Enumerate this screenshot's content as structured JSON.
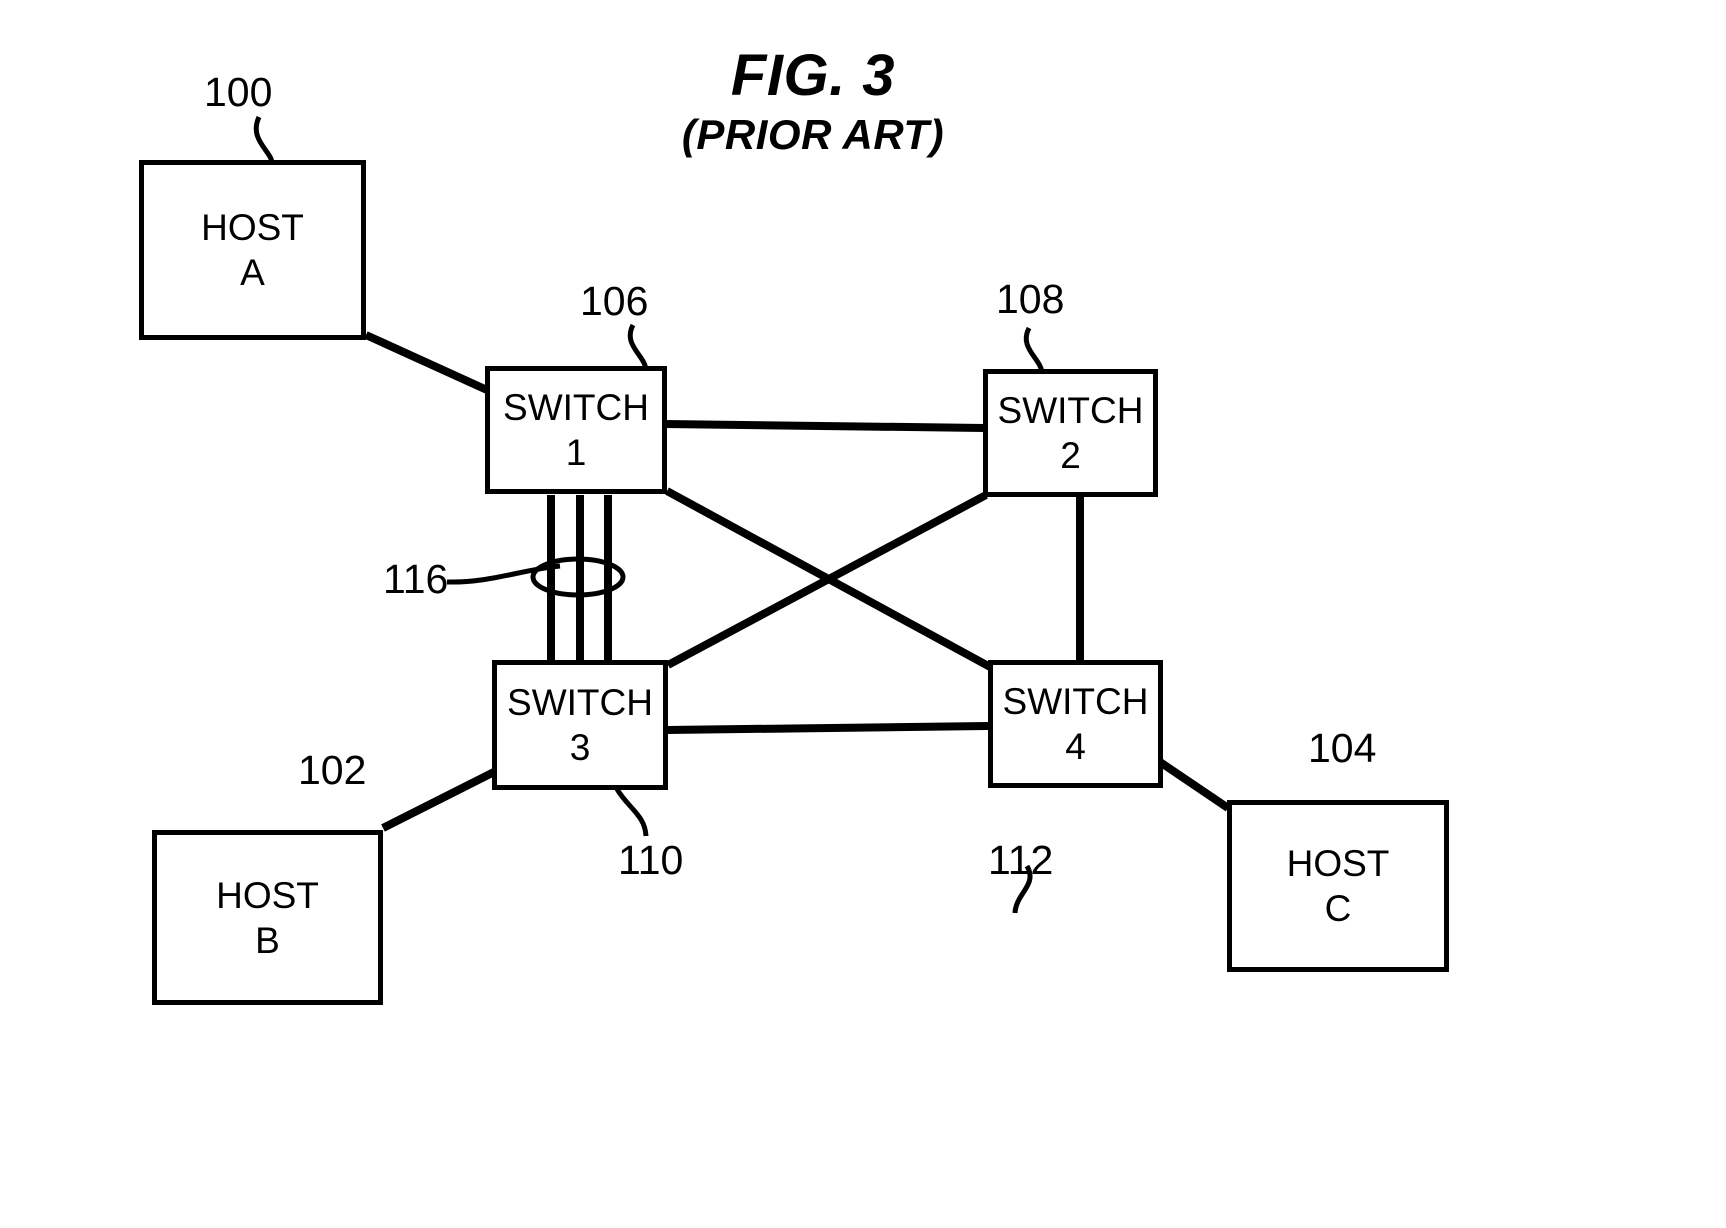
{
  "figure": {
    "title": "FIG. 3",
    "subtitle": "(PRIOR ART)",
    "type": "patent-network-diagram"
  },
  "nodes": [
    {
      "id": "host-a",
      "line1": "HOST",
      "line2": "A",
      "ref": "100"
    },
    {
      "id": "host-b",
      "line1": "HOST",
      "line2": "B",
      "ref": "102"
    },
    {
      "id": "host-c",
      "line1": "HOST",
      "line2": "C",
      "ref": "104"
    },
    {
      "id": "switch-1",
      "line1": "SWITCH",
      "line2": "1",
      "ref": "106"
    },
    {
      "id": "switch-2",
      "line1": "SWITCH",
      "line2": "2",
      "ref": "108"
    },
    {
      "id": "switch-3",
      "line1": "SWITCH",
      "line2": "3",
      "ref": "110"
    },
    {
      "id": "switch-4",
      "line1": "SWITCH",
      "line2": "4",
      "ref": "112"
    }
  ],
  "ref_labels": {
    "host_a": "100",
    "host_b": "102",
    "host_c": "104",
    "switch_1": "106",
    "switch_2": "108",
    "switch_3": "110",
    "switch_4": "112",
    "trunk": "116"
  },
  "links": [
    {
      "from": "host-a",
      "to": "switch-1",
      "style": "single"
    },
    {
      "from": "host-b",
      "to": "switch-3",
      "style": "single"
    },
    {
      "from": "host-c",
      "to": "switch-4",
      "style": "single"
    },
    {
      "from": "switch-1",
      "to": "switch-2",
      "style": "single"
    },
    {
      "from": "switch-1",
      "to": "switch-3",
      "style": "trunk-3-lines",
      "ref": "116"
    },
    {
      "from": "switch-1",
      "to": "switch-4",
      "style": "single"
    },
    {
      "from": "switch-2",
      "to": "switch-3",
      "style": "single"
    },
    {
      "from": "switch-2",
      "to": "switch-4",
      "style": "single"
    },
    {
      "from": "switch-3",
      "to": "switch-4",
      "style": "single"
    }
  ],
  "colors": {
    "line": "#000000",
    "background": "#ffffff",
    "text": "#000000"
  }
}
